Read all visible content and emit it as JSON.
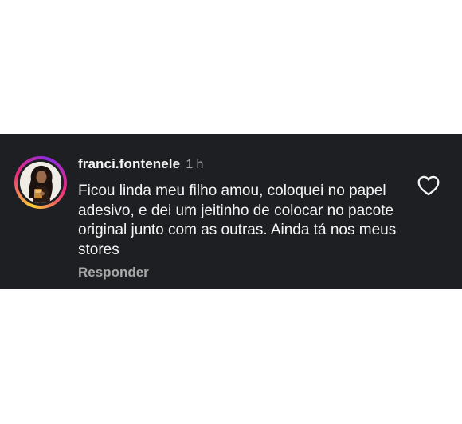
{
  "comment": {
    "username": "franci.fontenele",
    "timestamp": "1 h",
    "text": "Ficou linda meu filho amou, coloquei no papel adesivo, e dei um jeitinho de colocar no pacote original junto com as outras. Ainda tá nos meus stores",
    "reply_label": "Responder",
    "like_icon": "heart-outline-icon",
    "avatar_story_ring": true
  },
  "colors": {
    "background": "#1e1f22",
    "text_primary": "#f5f5f5",
    "text_secondary": "#a8a8a8",
    "story_ring_start": "#f9ce34",
    "story_ring_mid": "#ee2a7b",
    "story_ring_end": "#8a2be2"
  }
}
